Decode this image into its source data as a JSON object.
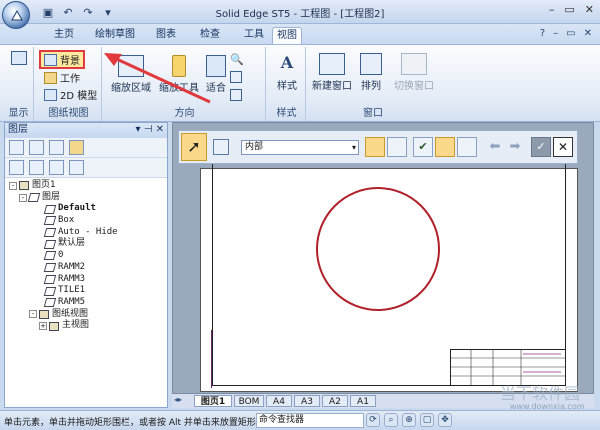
{
  "window": {
    "title": "Solid Edge ST5 - 工程图 - [工程图2]",
    "controls": [
      "–",
      "▭",
      "✕"
    ]
  },
  "ribbon_tabs": [
    "主页",
    "绘制草图",
    "图表",
    "检查",
    "工具",
    "视图"
  ],
  "active_tab": "视图",
  "ribbon_tab_right": {
    "help": "?",
    "min": "–",
    "restore": "▭",
    "close": "✕"
  },
  "groups": {
    "display": {
      "label": "显示"
    },
    "sheet_views": {
      "label": "图纸视图",
      "items": [
        "背景",
        "工作",
        "2D 模型"
      ]
    },
    "direction": {
      "label": "方向",
      "buttons": [
        "缩放区域",
        "缩放工具",
        "适合"
      ]
    },
    "style": {
      "label": "样式",
      "buttons": [
        "样式"
      ]
    },
    "window": {
      "label": "窗口",
      "buttons": [
        "新建窗口",
        "排列",
        "切换窗口"
      ]
    }
  },
  "layers_panel": {
    "title": "图层",
    "tree": [
      {
        "label": "图页1",
        "level": 0,
        "expander": "-"
      },
      {
        "label": "图层",
        "level": 1,
        "expander": "-"
      },
      {
        "label": "Default",
        "level": 2,
        "bold": true
      },
      {
        "label": "Box",
        "level": 2
      },
      {
        "label": "Auto - Hide",
        "level": 2
      },
      {
        "label": "默认层",
        "level": 2
      },
      {
        "label": "0",
        "level": 2
      },
      {
        "label": "RAMM2",
        "level": 2
      },
      {
        "label": "RAMM3",
        "level": 2
      },
      {
        "label": "TILE1",
        "level": 2
      },
      {
        "label": "RAMM5",
        "level": 2
      },
      {
        "label": "图纸视图",
        "level": 1,
        "expander": "-"
      },
      {
        "label": "主视图",
        "level": 2,
        "expander": "+"
      }
    ]
  },
  "command_bar": {
    "dropdown_value": "内部"
  },
  "sheet_tabs": [
    "图页1",
    "BOM",
    "A4",
    "A3",
    "A2",
    "A1"
  ],
  "active_sheet": "图页1",
  "status": {
    "text": "单击元素，单击并拖动矩形围栏，或者按 Alt 并单击来放置矩形",
    "finder_label": "命令查找器"
  },
  "watermark": {
    "brand": "当下软件园",
    "url": "www.downxia.com"
  },
  "colors": {
    "highlight_red": "#e0393e",
    "circle": "#b0202a"
  }
}
